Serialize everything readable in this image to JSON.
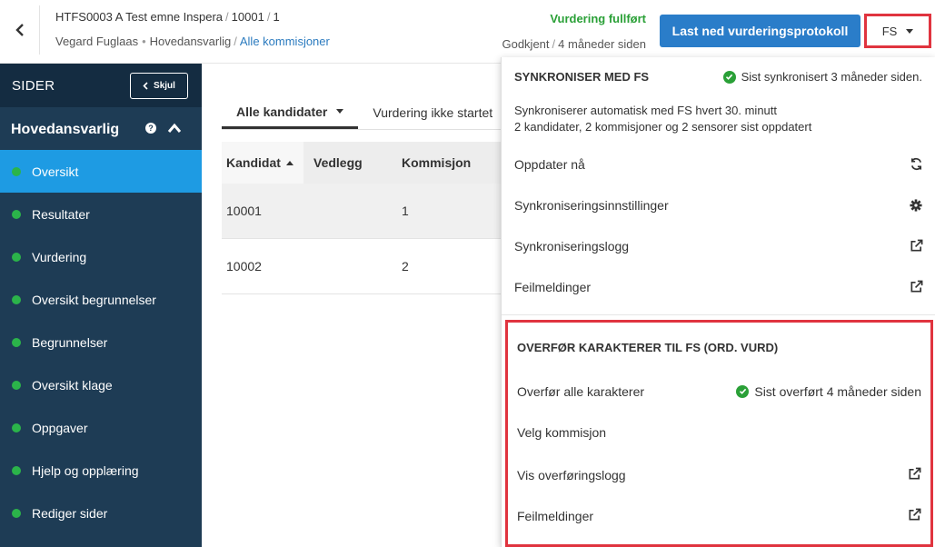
{
  "header": {
    "course_code": "HTFS0003 A Test emne Inspera",
    "candidate_no": "10001",
    "page_no": "1",
    "user_name": "Vegard Fuglaas",
    "role": "Hovedansvarlig",
    "committees_link": "Alle kommisjoner",
    "assessment_status": "Vurdering fullført",
    "approved": "Godkjent",
    "approved_time": "4 måneder siden",
    "download_button": "Last ned vurderingsprotokoll",
    "fs_button": "FS"
  },
  "sidebar": {
    "title": "SIDER",
    "hide_button": "Skjul",
    "section": "Hovedansvarlig",
    "items": [
      {
        "label": "Oversikt",
        "active": true
      },
      {
        "label": "Resultater"
      },
      {
        "label": "Vurdering"
      },
      {
        "label": "Oversikt begrunnelser"
      },
      {
        "label": "Begrunnelser"
      },
      {
        "label": "Oversikt klage"
      },
      {
        "label": "Oppgaver"
      },
      {
        "label": "Hjelp og opplæring"
      },
      {
        "label": "Rediger sider"
      }
    ]
  },
  "main": {
    "tabs": [
      {
        "label": "Alle kandidater"
      },
      {
        "label": "Vurdering ikke startet"
      }
    ],
    "table": {
      "columns": [
        "Kandidat",
        "Vedlegg",
        "Kommisjon"
      ],
      "rows": [
        {
          "kandidat": "10001",
          "vedlegg": "",
          "kommisjon": "1"
        },
        {
          "kandidat": "10002",
          "vedlegg": "",
          "kommisjon": "2"
        }
      ]
    }
  },
  "fs_dropdown": {
    "sync_heading": "SYNKRONISER MED FS",
    "sync_status": "Sist synkronisert 3 måneder siden.",
    "sync_desc_line1": "Synkroniserer automatisk med FS hvert 30. minutt",
    "sync_desc_line2": "2 kandidater, 2 kommisjoner og 2 sensorer sist oppdatert",
    "update_now": "Oppdater nå",
    "sync_settings": "Synkroniseringsinnstillinger",
    "sync_log": "Synkroniseringslogg",
    "error_messages": "Feilmeldinger",
    "transfer_heading": "OVERFØR KARAKTERER TIL FS (ORD. VURD)",
    "transfer_all": "Overfør alle karakterer",
    "transfer_status": "Sist overført 4 måneder siden",
    "select_committee": "Velg kommisjon",
    "transfer_log": "Vis overføringslogg",
    "transfer_errors": "Feilmeldinger"
  },
  "colors": {
    "sidebar_bg": "#1e3c55",
    "sidebar_active": "#1e9be3",
    "primary_button": "#2a7dc9",
    "success": "#2aa037",
    "highlight": "#e0343f"
  }
}
